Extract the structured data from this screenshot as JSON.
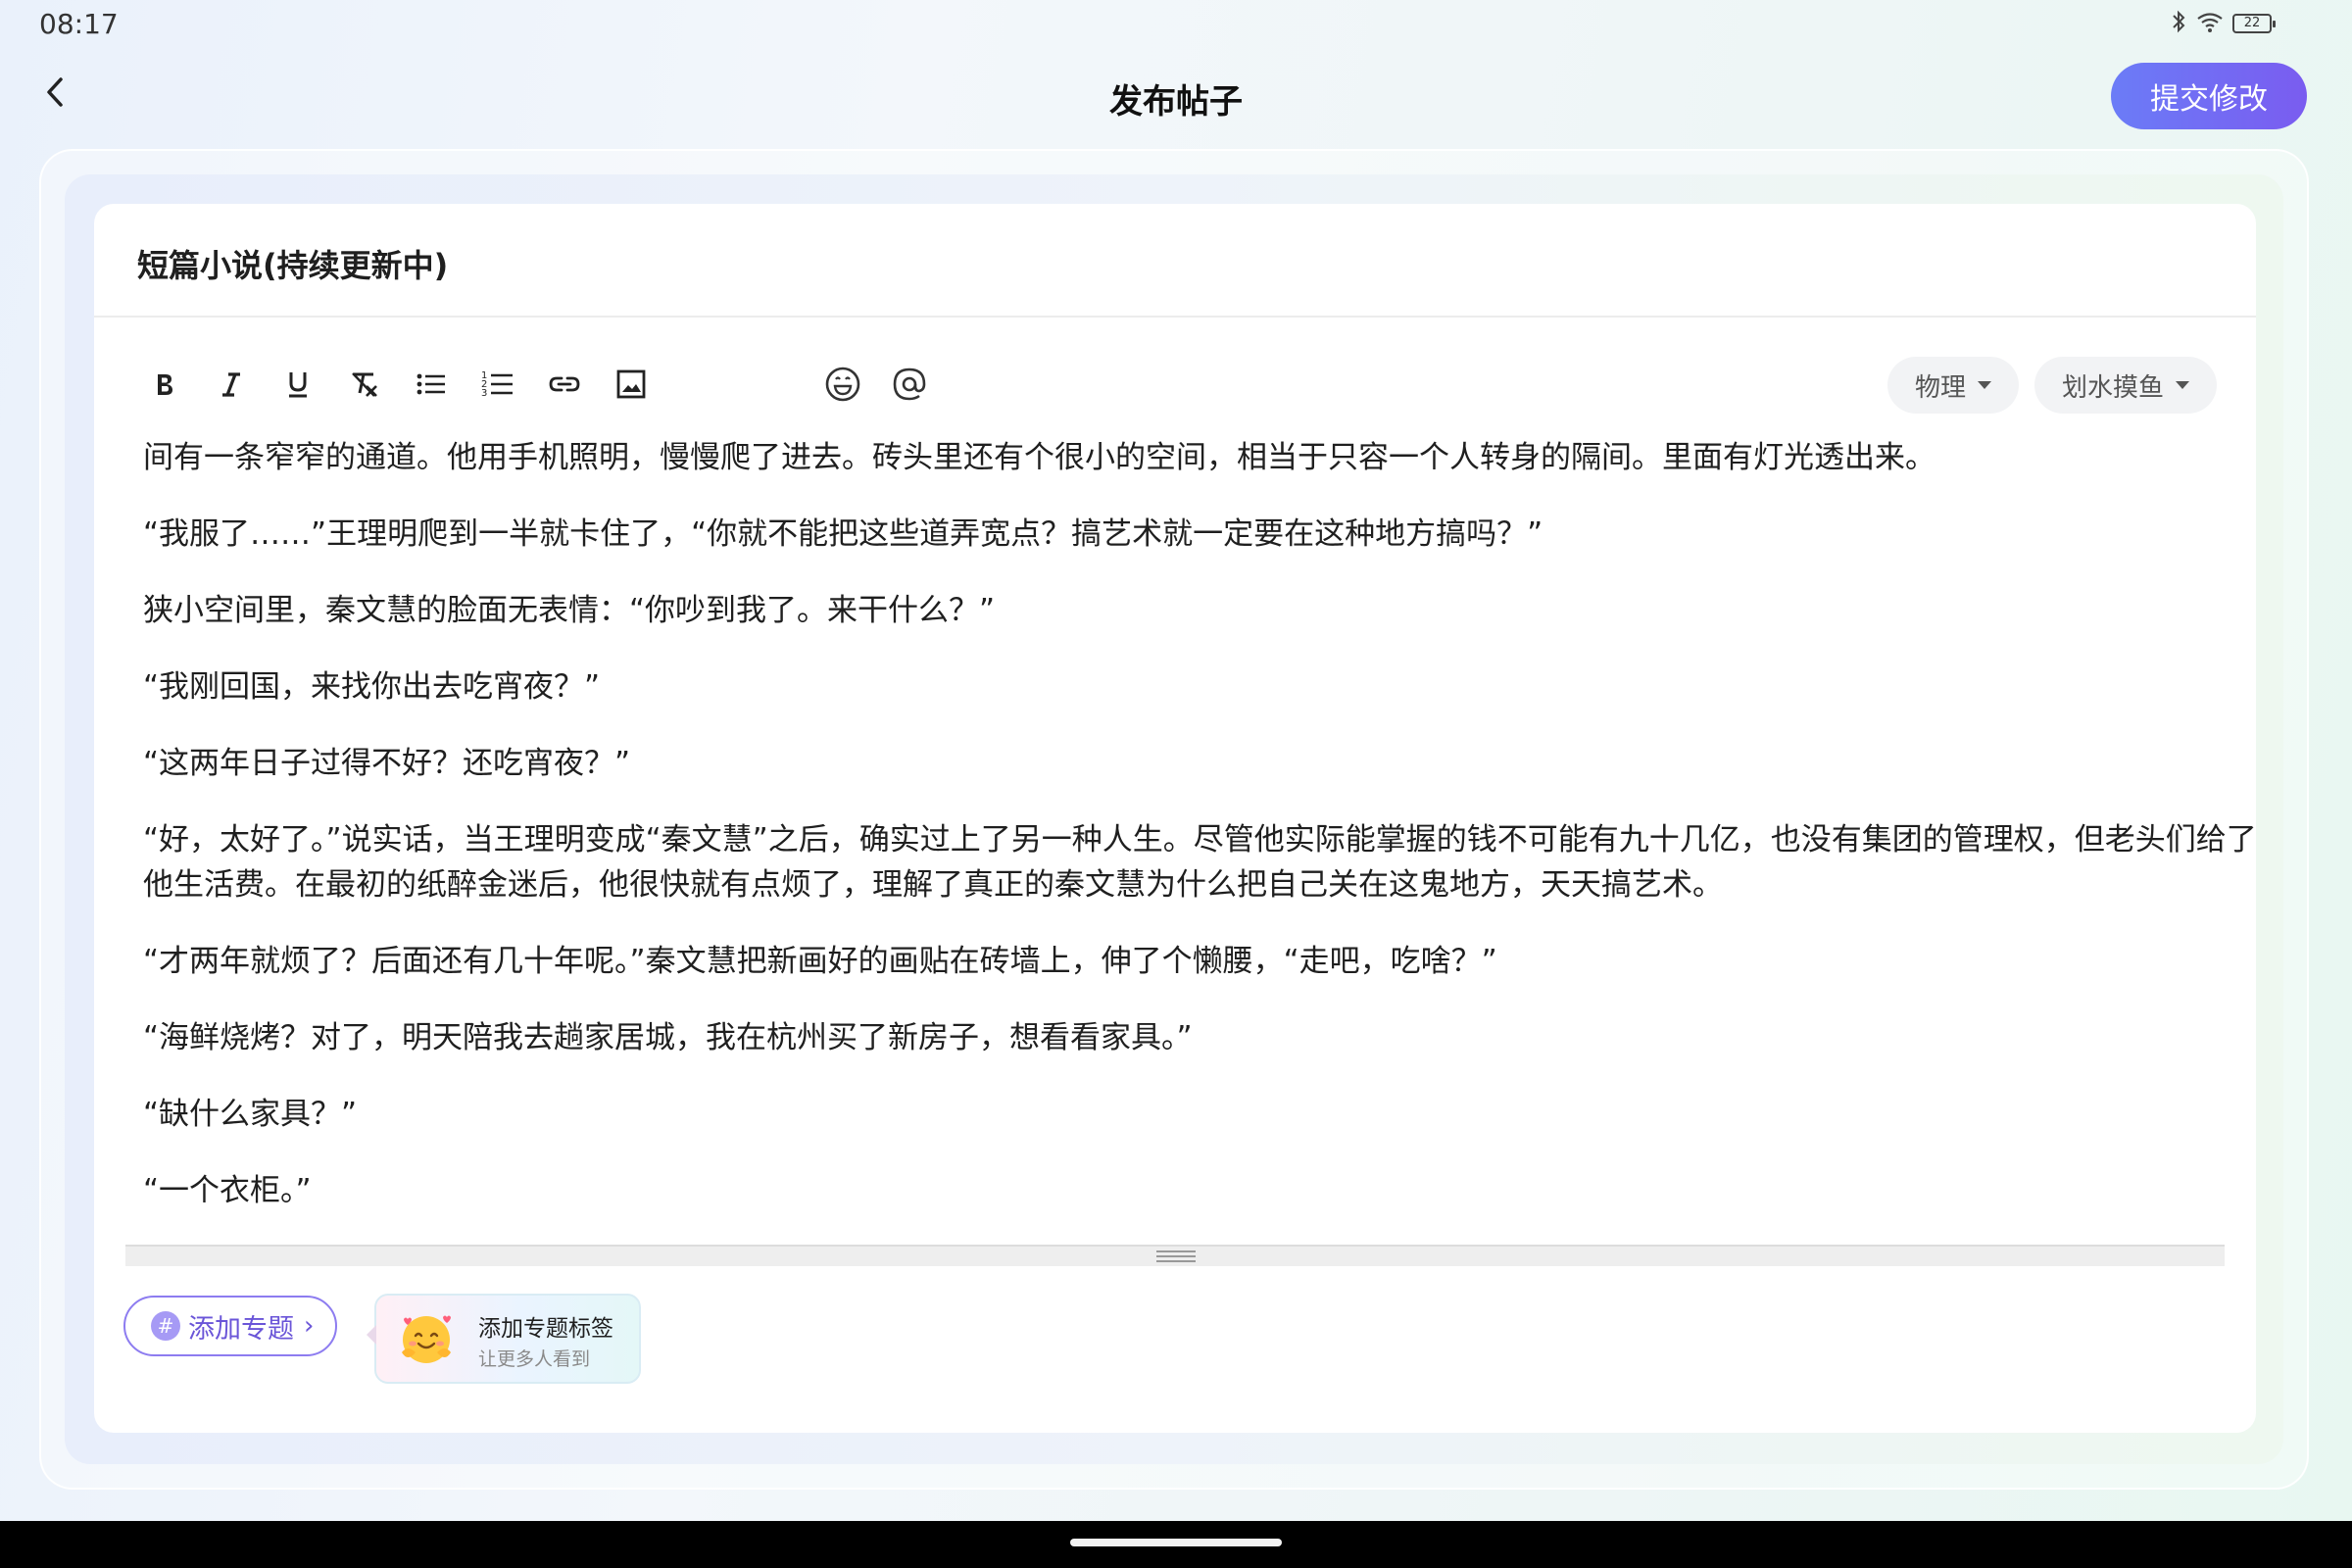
{
  "status_bar": {
    "time": "08:17",
    "battery_level": "22"
  },
  "header": {
    "title": "发布帖子",
    "submit_label": "提交修改"
  },
  "post": {
    "title": "短篇小说(持续更新中)",
    "tags": [
      "物理",
      "划水摸鱼"
    ],
    "paragraphs": [
      "间有一条窄窄的通道。他用手机照明，慢慢爬了进去。砖头里还有个很小的空间，相当于只容一个人转身的隔间。里面有灯光透出来。",
      "“我服了……”王理明爬到一半就卡住了，“你就不能把这些道弄宽点？搞艺术就一定要在这种地方搞吗？”",
      "狭小空间里，秦文慧的脸面无表情：“你吵到我了。来干什么？”",
      "“我刚回国，来找你出去吃宵夜？”",
      "“这两年日子过得不好？还吃宵夜？”",
      "“好，太好了。”说实话，当王理明变成“秦文慧”之后，确实过上了另一种人生。尽管他实际能掌握的钱不可能有九十几亿，也没有集团的管理权，但老头们给了他生活费。在最初的纸醉金迷后，他很快就有点烦了，理解了真正的秦文慧为什么把自己关在这鬼地方，天天搞艺术。",
      "“才两年就烦了？后面还有几十年呢。”秦文慧把新画好的画贴在砖墙上，伸了个懒腰，“走吧，吃啥？”",
      "“海鲜烧烤？对了，明天陪我去趟家居城，我在杭州买了新房子，想看看家具。”",
      "“缺什么家具？”",
      "“一个衣柜。”"
    ]
  },
  "footer": {
    "topic_button_label": "添加专题",
    "tip_title": "添加专题标签",
    "tip_subtitle": "让更多人看到"
  },
  "colors": {
    "submit_gradient_start": "#6b7cf7",
    "submit_gradient_end": "#7a5cf0",
    "topic_accent": "#6a55d8"
  },
  "icons": [
    "back-arrow-icon",
    "bold-icon",
    "italic-icon",
    "underline-icon",
    "clear-format-icon",
    "bullet-list-icon",
    "numbered-list-icon",
    "link-icon",
    "image-icon",
    "emoji-icon",
    "mention-icon",
    "dropdown-caret-icon",
    "hash-icon",
    "chevron-right-icon",
    "smiling-face-emoji-icon",
    "bluetooth-icon",
    "wifi-icon",
    "battery-icon"
  ]
}
